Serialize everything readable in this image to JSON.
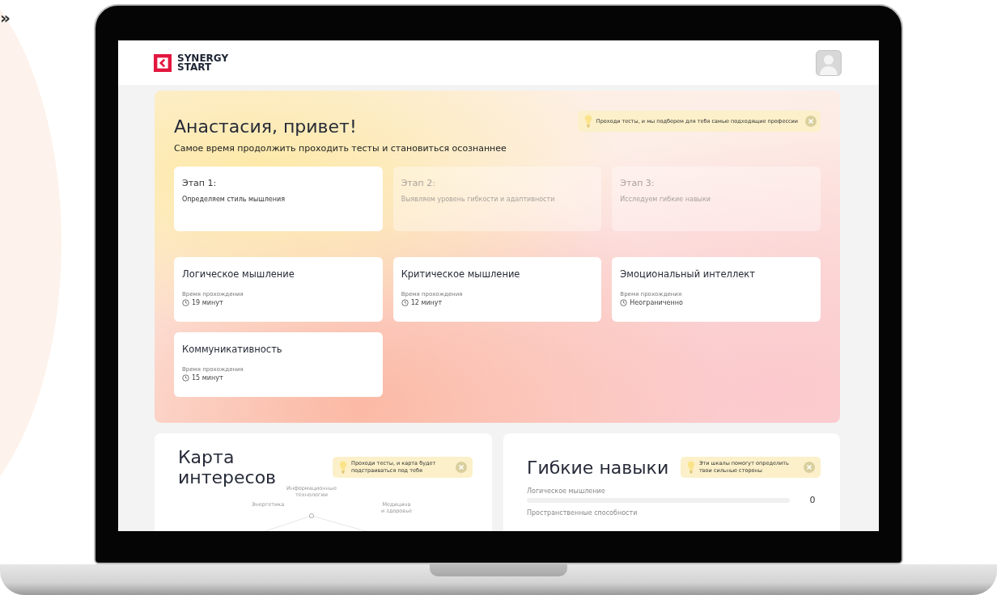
{
  "decor": {
    "chevron": "»"
  },
  "header": {
    "logo_lines": [
      "SYNERGY",
      "START"
    ]
  },
  "hero": {
    "title": "Анастасия, привет!",
    "subtitle": "Самое время продолжить проходить тесты и становиться осознаннее",
    "tip": "Проходи тесты, и мы подберем для тебя самые подходящие профессии",
    "stages": [
      {
        "label": "Этап 1:",
        "text": "Определяем стиль мышления",
        "active": true
      },
      {
        "label": "Этап 2:",
        "text": "Выявляем уровень гибкости и адаптивности",
        "active": false
      },
      {
        "label": "Этап 3:",
        "text": "Исследуем гибкие навыки",
        "active": false
      }
    ],
    "tests": [
      {
        "title": "Логическое мышление",
        "time_label": "Время прохождения",
        "time": "19 минут"
      },
      {
        "title": "Критическое мышление",
        "time_label": "Время прохождения",
        "time": "12 минут"
      },
      {
        "title": "Эмоциональный интеллект",
        "time_label": "Время прохождения",
        "time": "Неограниченно"
      },
      {
        "title": "Коммуникативность",
        "time_label": "Время прохождения",
        "time": "15 минут"
      }
    ]
  },
  "interests": {
    "title": "Карта интересов",
    "tip": "Проходи тесты, и карта будет подстраиваться под тебя",
    "map_labels": [
      {
        "text": "Энергетика",
        "kind": "left"
      },
      {
        "text": "Информационные технологии",
        "kind": "top"
      },
      {
        "text": "Медицина и здоровье",
        "kind": "right"
      }
    ]
  },
  "skills": {
    "title": "Гибкие навыки",
    "tip": "Эти шкалы помогут определить твои сильные стороны",
    "items": [
      {
        "name": "Логическое мышление",
        "level": 0,
        "reading": "0"
      },
      {
        "name": "Пространственные способности"
      }
    ]
  }
}
